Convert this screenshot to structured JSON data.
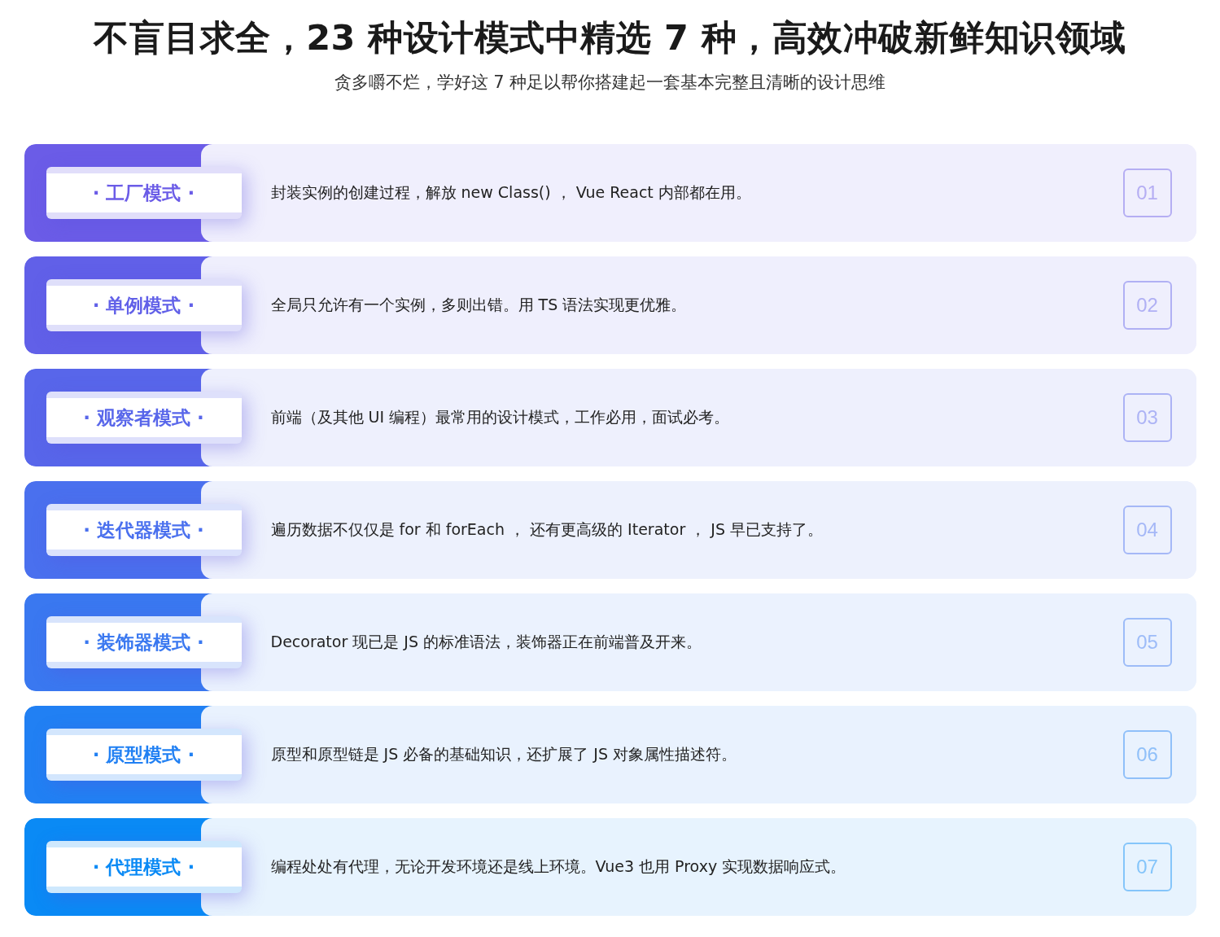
{
  "title": "不盲目求全，23 种设计模式中精选 7 种，高效冲破新鲜知识领域",
  "subtitle": "贪多嚼不烂，学好这 7 种足以帮你搭建起一套基本完整且清晰的设计思维",
  "patterns": [
    {
      "label": "· 工厂模式 ·",
      "description": "封装实例的创建过程，解放 new Class() ， Vue React 内部都在用。",
      "number": "01",
      "color": "#6b5ce7"
    },
    {
      "label": "· 单例模式 ·",
      "description": "全局只允许有一个实例，多则出错。用 TS 语法实现更优雅。",
      "number": "02",
      "color": "#6160e8"
    },
    {
      "label": "· 观察者模式 ·",
      "description": "前端（及其他 UI 编程）最常用的设计模式，工作必用，面试必考。",
      "number": "03",
      "color": "#5866ea"
    },
    {
      "label": "· 迭代器模式 ·",
      "description": "遍历数据不仅仅是 for 和 forEach ， 还有更高级的 Iterator ， JS 早已支持了。",
      "number": "04",
      "color": "#4a70ee"
    },
    {
      "label": "· 装饰器模式 ·",
      "description": "Decorator 现已是 JS 的标准语法，装饰器正在前端普及开来。",
      "number": "05",
      "color": "#3a78f0"
    },
    {
      "label": "· 原型模式 ·",
      "description": "原型和原型链是 JS 必备的基础知识，还扩展了 JS 对象属性描述符。",
      "number": "06",
      "color": "#2180f3"
    },
    {
      "label": "· 代理模式 ·",
      "description": "编程处处有代理，无论开发环境还是线上环境。Vue3 也用 Proxy 实现数据响应式。",
      "number": "07",
      "color": "#0a8af5"
    }
  ]
}
